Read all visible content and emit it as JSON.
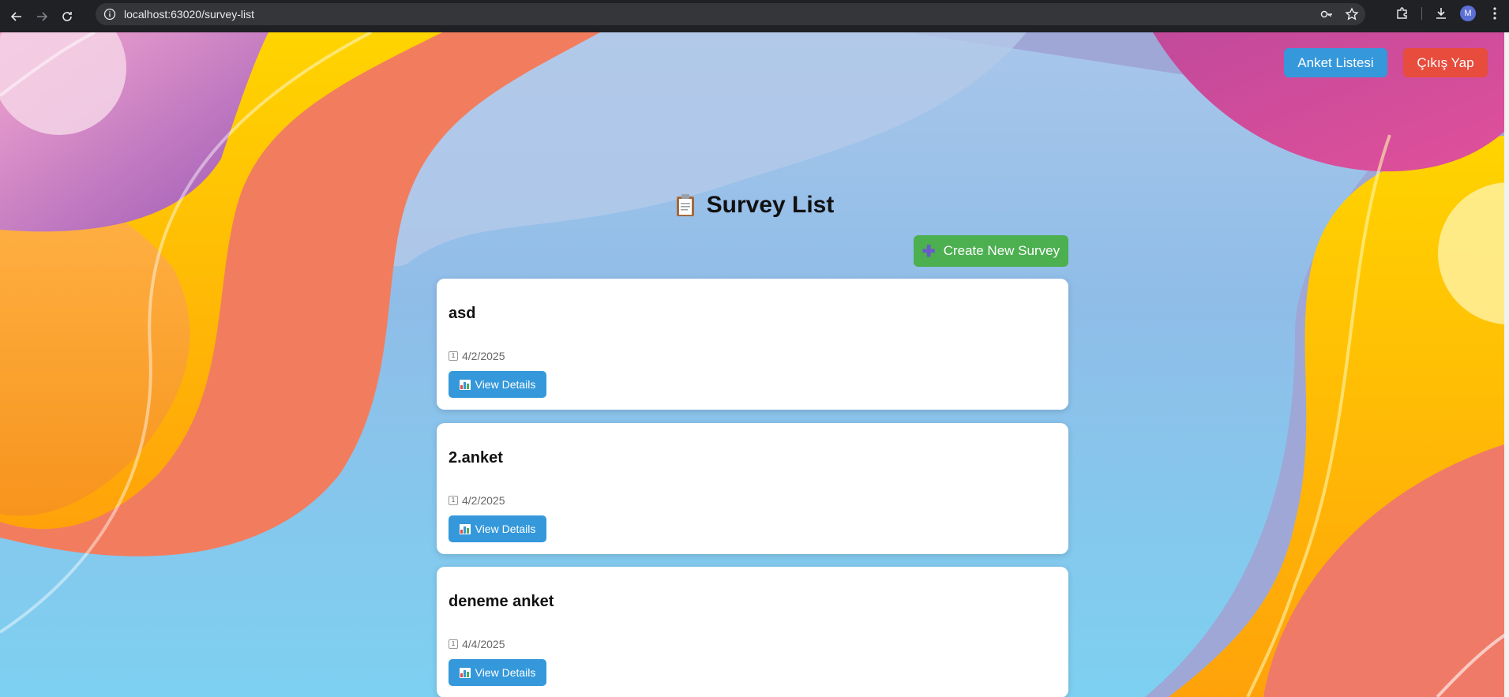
{
  "browser": {
    "url": "localhost:63020/survey-list",
    "avatar_letter": "M"
  },
  "nav": {
    "survey_list_label": "Anket Listesi",
    "logout_label": "Çıkış Yap"
  },
  "page": {
    "title_icon": "clipboard-icon",
    "title": "Survey List",
    "create_icon": "plus-icon",
    "create_label": "Create New Survey"
  },
  "surveys": [
    {
      "title": "asd",
      "date": "4/2/2025",
      "button_label": "View Details"
    },
    {
      "title": "2.anket",
      "date": "4/2/2025",
      "button_label": "View Details"
    },
    {
      "title": "deneme anket",
      "date": "4/4/2025",
      "button_label": "View Details"
    }
  ],
  "colors": {
    "primary_blue": "#3498db",
    "danger_red": "#e74c3c",
    "success_green": "#4caf50"
  }
}
